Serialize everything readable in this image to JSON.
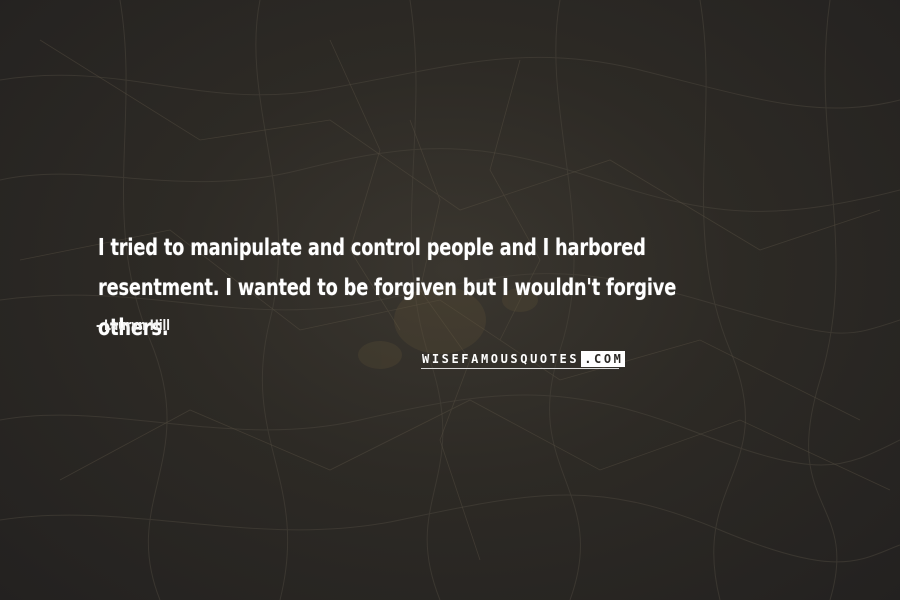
{
  "quote": {
    "text": "I tried to manipulate and control people and I harbored resentment. I wanted to be forgiven but I wouldn't forgive others.",
    "author_dash": "-",
    "author": "Lauryn Hill"
  },
  "logo": {
    "part_a": "WISEFAMOUSQUOTES",
    "part_b": ".COM"
  },
  "colors": {
    "background": "#2a2824",
    "text": "#ffffff"
  }
}
